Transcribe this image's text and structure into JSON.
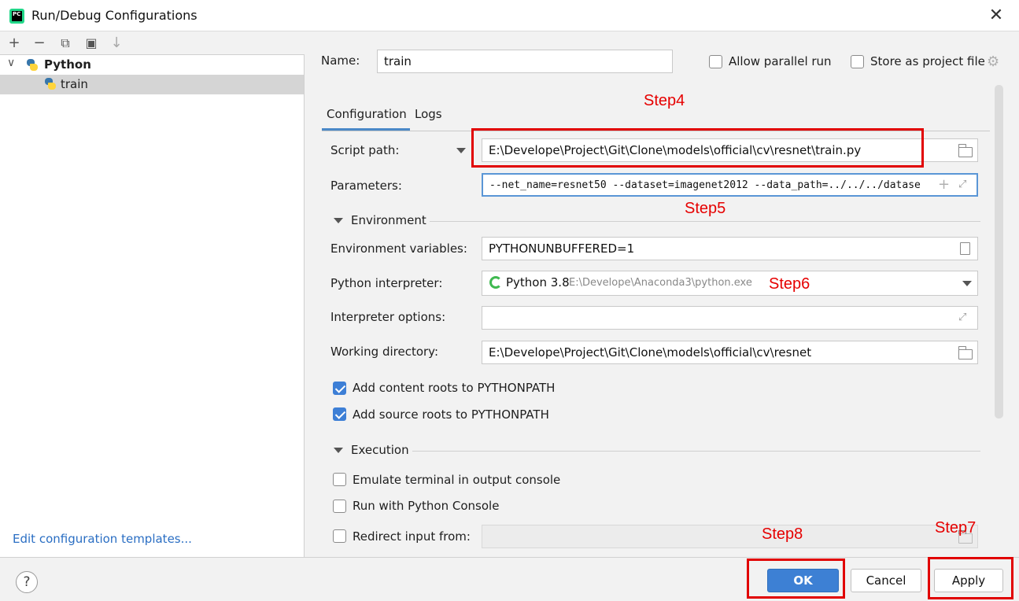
{
  "window": {
    "title": "Run/Debug Configurations",
    "close_glyph": "✕"
  },
  "left_toolbar": {
    "icons": [
      "add-icon",
      "remove-icon",
      "copy-icon",
      "folder-add-icon",
      "sort-icon"
    ],
    "glyphs": [
      "+",
      "−",
      "⧉",
      "▣",
      "↓"
    ]
  },
  "tree": {
    "root_label": "Python",
    "child_label": "train",
    "expand_glyph": "∨"
  },
  "edit_templates_link": "Edit configuration templates...",
  "header": {
    "name_label": "Name:",
    "name_value": "train",
    "allow_parallel_label": "Allow parallel run",
    "store_project_label": "Store as project file"
  },
  "tabs": [
    {
      "label": "Configuration",
      "active": true
    },
    {
      "label": "Logs",
      "active": false
    }
  ],
  "config": {
    "script_path_label": "Script path:",
    "script_path_value": "E:\\Develope\\Project\\Git\\Clone\\models\\official\\cv\\resnet\\train.py",
    "parameters_label": "Parameters:",
    "parameters_value": "--net_name=resnet50 --dataset=imagenet2012 --data_path=../../../datase",
    "environment_section": "Environment",
    "env_vars_label": "Environment variables:",
    "env_vars_value": "PYTHONUNBUFFERED=1",
    "interpreter_label": "Python interpreter:",
    "interpreter_name": "Python 3.8",
    "interpreter_path": "E:\\Develope\\Anaconda3\\python.exe",
    "interp_options_label": "Interpreter options:",
    "interp_options_value": "",
    "working_dir_label": "Working directory:",
    "working_dir_value": "E:\\Develope\\Project\\Git\\Clone\\models\\official\\cv\\resnet",
    "add_content_roots_label": "Add content roots to PYTHONPATH",
    "add_source_roots_label": "Add source roots to PYTHONPATH",
    "execution_section": "Execution",
    "emulate_terminal_label": "Emulate terminal in output console",
    "run_python_console_label": "Run with Python Console",
    "redirect_input_label": "Redirect input from:"
  },
  "checkbox_states": {
    "allow_parallel": false,
    "store_project": false,
    "add_content_roots": true,
    "add_source_roots": true,
    "emulate_terminal": false,
    "run_python_console": false,
    "redirect_input": false
  },
  "buttons": {
    "help": "?",
    "ok": "OK",
    "cancel": "Cancel",
    "apply": "Apply"
  },
  "annotations": {
    "step4": "Step4",
    "step5": "Step5",
    "step6": "Step6",
    "step7": "Step7",
    "step8": "Step8",
    "color": "#e10000"
  },
  "colors": {
    "accent": "#3d80d4",
    "link": "#2a6ec3",
    "tab_underline": "#4a88c7"
  }
}
